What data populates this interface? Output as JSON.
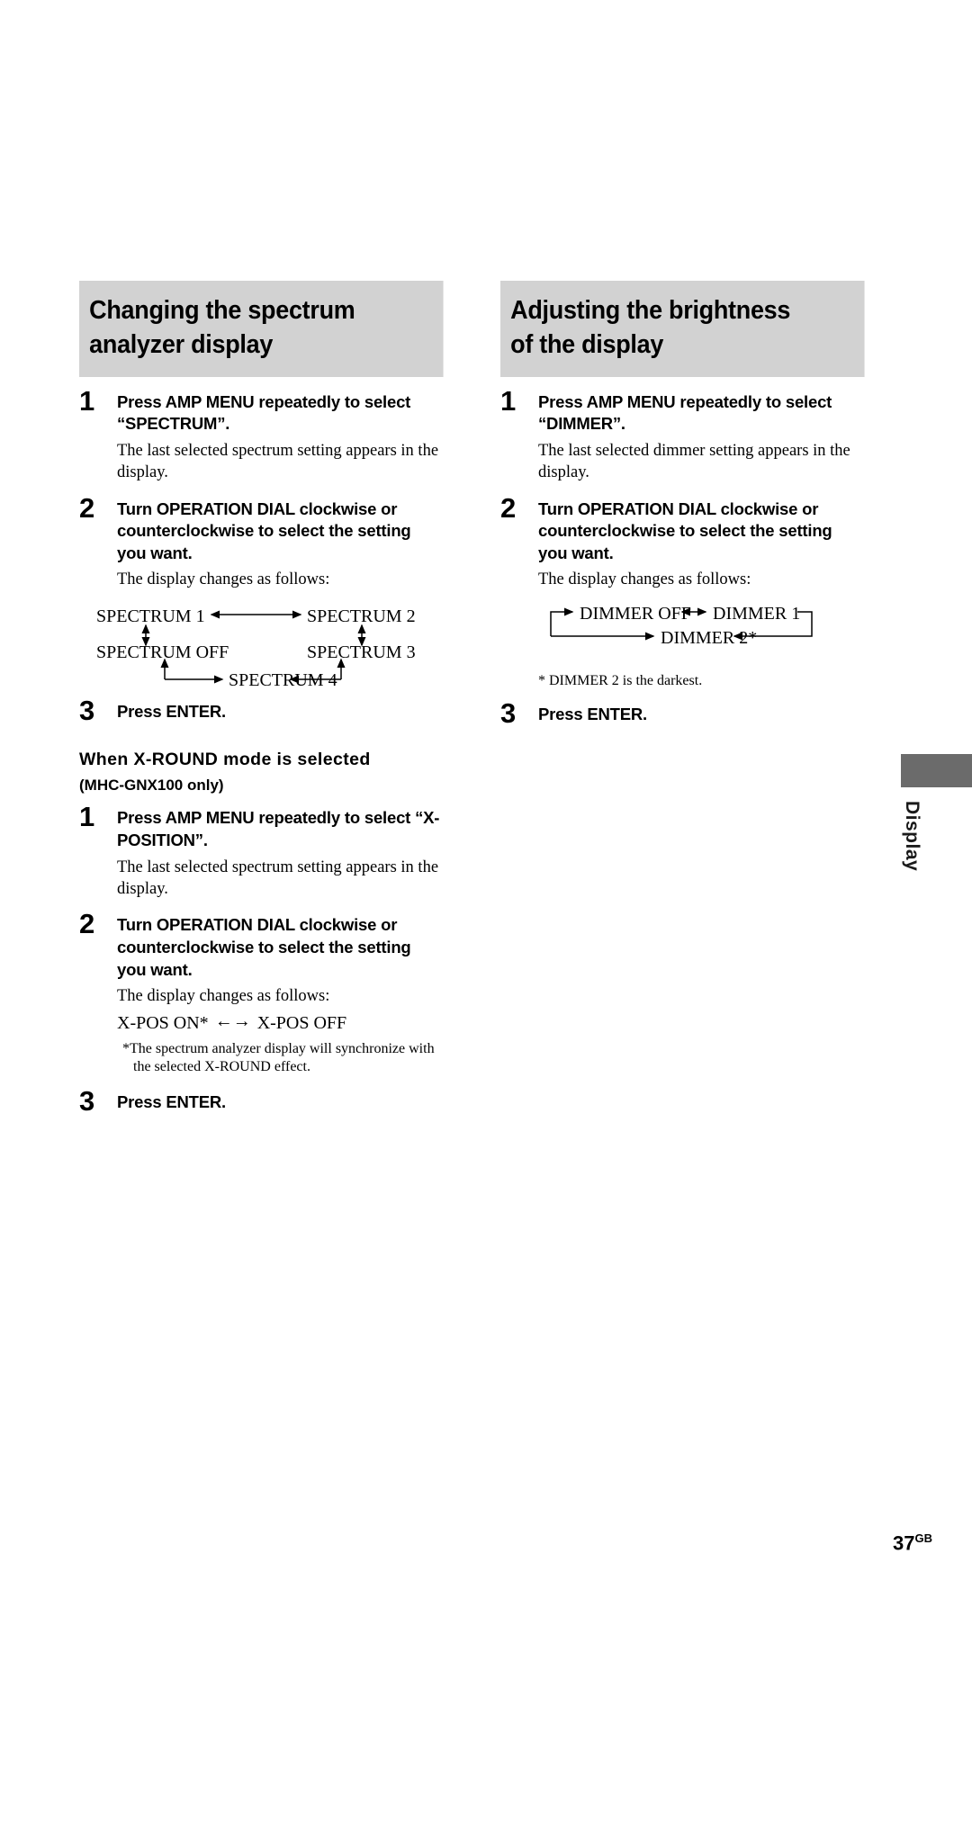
{
  "page": {
    "number": "37",
    "region_suffix": "GB",
    "side_tab_label": "Display"
  },
  "left_column": {
    "heading_line1": "Changing the spectrum",
    "heading_line2": "analyzer display",
    "steps": [
      {
        "num": "1",
        "title": "Press AMP MENU repeatedly to select “SPECTRUM”.",
        "body": "The last selected spectrum setting appears in the display."
      },
      {
        "num": "2",
        "title": "Turn OPERATION DIAL clockwise or counterclockwise to select the setting you want.",
        "body": "The display changes as follows:"
      },
      {
        "num": "3",
        "title": "Press ENTER.",
        "body": ""
      }
    ],
    "spectrum_flow": {
      "label_1": "SPECTRUM 1",
      "label_2": "SPECTRUM 2",
      "label_off": "SPECTRUM OFF",
      "label_3": "SPECTRUM 3",
      "label_4": "SPECTRUM 4"
    },
    "xround": {
      "sub_head": "When X-ROUND mode is selected",
      "sub_note": "(MHC-GNX100 only)",
      "steps": [
        {
          "num": "1",
          "title": "Press AMP MENU repeatedly to select “X-POSITION”.",
          "body": "The last selected spectrum setting appears in the display."
        },
        {
          "num": "2",
          "title": "Turn OPERATION DIAL clockwise or counterclockwise to select the setting you want.",
          "body": "The display changes as follows:"
        },
        {
          "num": "3",
          "title": "Press ENTER.",
          "body": ""
        }
      ],
      "inline_flow_left": "X-POS ON*",
      "inline_flow_arrow": "←→",
      "inline_flow_right": "X-POS OFF",
      "footnote": "*The spectrum analyzer display will synchronize with the selected X-ROUND effect."
    }
  },
  "right_column": {
    "heading_line1": "Adjusting the brightness",
    "heading_line2": "of the display",
    "steps": [
      {
        "num": "1",
        "title": "Press AMP MENU repeatedly to select “DIMMER”.",
        "body": "The last selected dimmer setting appears in the display."
      },
      {
        "num": "2",
        "title": "Turn OPERATION DIAL clockwise or counterclockwise to select the setting you want.",
        "body": "The display changes as follows:"
      },
      {
        "num": "3",
        "title": "Press ENTER.",
        "body": ""
      }
    ],
    "dimmer_flow": {
      "label_off": "DIMMER OFF",
      "label_1": "DIMMER 1",
      "label_2": "DIMMER 2*"
    },
    "dimmer_footnote": "*  DIMMER 2 is the darkest."
  },
  "colors": {
    "heading_band": "#d2d2d2",
    "side_tab_block": "#6b6b6b",
    "text": "#000000"
  }
}
